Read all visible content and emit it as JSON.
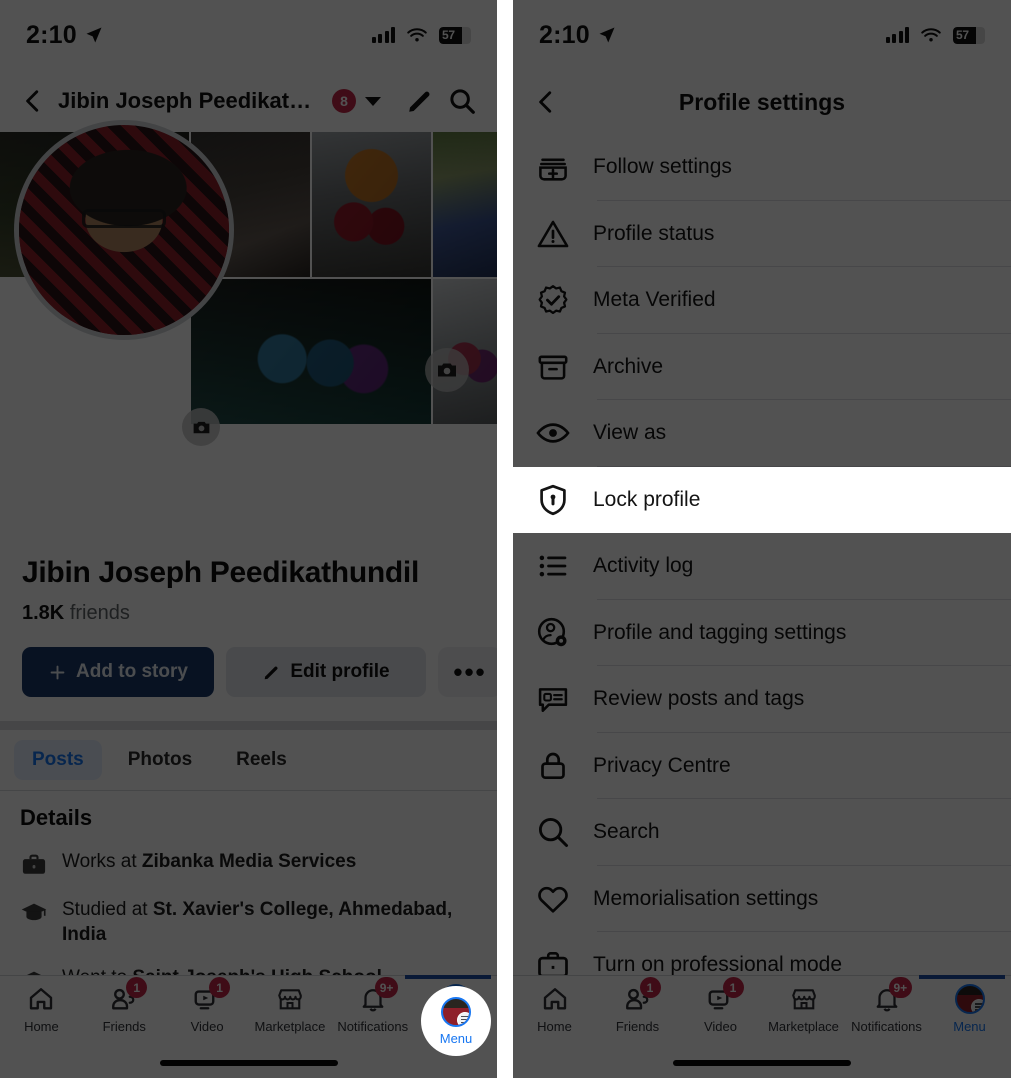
{
  "status_bar": {
    "time": "2:10",
    "battery_percent": "57",
    "location_icon": "location-arrow-icon",
    "signal_icon": "cellular-bars-icon",
    "wifi_icon": "wifi-icon",
    "battery_icon": "battery-icon"
  },
  "left_phone": {
    "topbar": {
      "back_icon": "back-chevron-icon",
      "profile_name": "Jibin Joseph Peedikathundil",
      "notification_badge": "8",
      "dropdown_icon": "caret-down-icon",
      "edit_icon": "pencil-icon",
      "search_icon": "search-icon"
    },
    "cover": {
      "camera_icon": "camera-icon"
    },
    "avatar": {
      "camera_icon": "camera-icon"
    },
    "identity": {
      "name": "Jibin Joseph Peedikathundil",
      "friends_count": "1.8K",
      "friends_label": "friends"
    },
    "actions": {
      "add_story_label": "Add to story",
      "add_story_icon": "plus-icon",
      "edit_profile_label": "Edit profile",
      "edit_profile_icon": "pencil-icon",
      "more_label": "•••"
    },
    "tabs": [
      {
        "label": "Posts",
        "active": true
      },
      {
        "label": "Photos",
        "active": false
      },
      {
        "label": "Reels",
        "active": false
      }
    ],
    "details": {
      "heading": "Details",
      "rows": [
        {
          "icon": "briefcase-icon",
          "prefix": "Works at ",
          "value": "Zibanka Media Services"
        },
        {
          "icon": "graduation-cap-icon",
          "prefix": "Studied at ",
          "value": "St. Xavier's College, Ahmedabad, India"
        },
        {
          "icon": "graduation-cap-icon",
          "prefix": "Went to ",
          "value": "Saint Joseph's High School"
        }
      ]
    },
    "bottom_nav": {
      "items": [
        {
          "label": "Home",
          "icon": "home-icon",
          "badge": "",
          "selected": false
        },
        {
          "label": "Friends",
          "icon": "friends-icon",
          "badge": "1",
          "selected": false
        },
        {
          "label": "Video",
          "icon": "video-icon",
          "badge": "1",
          "selected": false
        },
        {
          "label": "Marketplace",
          "icon": "marketplace-icon",
          "badge": "",
          "selected": false
        },
        {
          "label": "Notifications",
          "icon": "bell-icon",
          "badge": "9+",
          "selected": false
        },
        {
          "label": "Menu",
          "icon": "menu-avatar-icon",
          "badge": "",
          "selected": true
        }
      ]
    }
  },
  "right_phone": {
    "topbar": {
      "back_icon": "back-chevron-icon",
      "title": "Profile settings"
    },
    "settings_items": [
      {
        "label": "Follow settings",
        "icon": "follow-stack-plus-icon",
        "highlighted": false
      },
      {
        "label": "Profile status",
        "icon": "warning-triangle-icon",
        "highlighted": false
      },
      {
        "label": "Meta Verified",
        "icon": "verified-badge-icon",
        "highlighted": false
      },
      {
        "label": "Archive",
        "icon": "archive-box-icon",
        "highlighted": false
      },
      {
        "label": "View as",
        "icon": "eye-icon",
        "highlighted": false
      },
      {
        "label": "Lock profile",
        "icon": "shield-lock-icon",
        "highlighted": true
      },
      {
        "label": "Activity log",
        "icon": "list-bullets-icon",
        "highlighted": false
      },
      {
        "label": "Profile and tagging settings",
        "icon": "person-gear-icon",
        "highlighted": false
      },
      {
        "label": "Review posts and tags",
        "icon": "comment-list-icon",
        "highlighted": false
      },
      {
        "label": "Privacy Centre",
        "icon": "padlock-icon",
        "highlighted": false
      },
      {
        "label": "Search",
        "icon": "search-icon",
        "highlighted": false
      },
      {
        "label": "Memorialisation settings",
        "icon": "heart-icon",
        "highlighted": false
      },
      {
        "label": "Turn on professional mode",
        "icon": "briefcase-icon",
        "highlighted": false
      }
    ],
    "bottom_nav": {
      "items": [
        {
          "label": "Home",
          "icon": "home-icon",
          "badge": "",
          "selected": false
        },
        {
          "label": "Friends",
          "icon": "friends-icon",
          "badge": "1",
          "selected": false
        },
        {
          "label": "Video",
          "icon": "video-icon",
          "badge": "1",
          "selected": false
        },
        {
          "label": "Marketplace",
          "icon": "marketplace-icon",
          "badge": "",
          "selected": false
        },
        {
          "label": "Notifications",
          "icon": "bell-icon",
          "badge": "9+",
          "selected": false
        },
        {
          "label": "Menu",
          "icon": "menu-avatar-icon",
          "badge": "",
          "selected": true
        }
      ]
    }
  },
  "colors": {
    "accent_blue": "#1877f2",
    "badge_red": "#c42847",
    "story_button": "#1b3a6b",
    "dim_overlay": "rgba(0,0,0,0.68)",
    "highlight_row": "#ffffff"
  }
}
